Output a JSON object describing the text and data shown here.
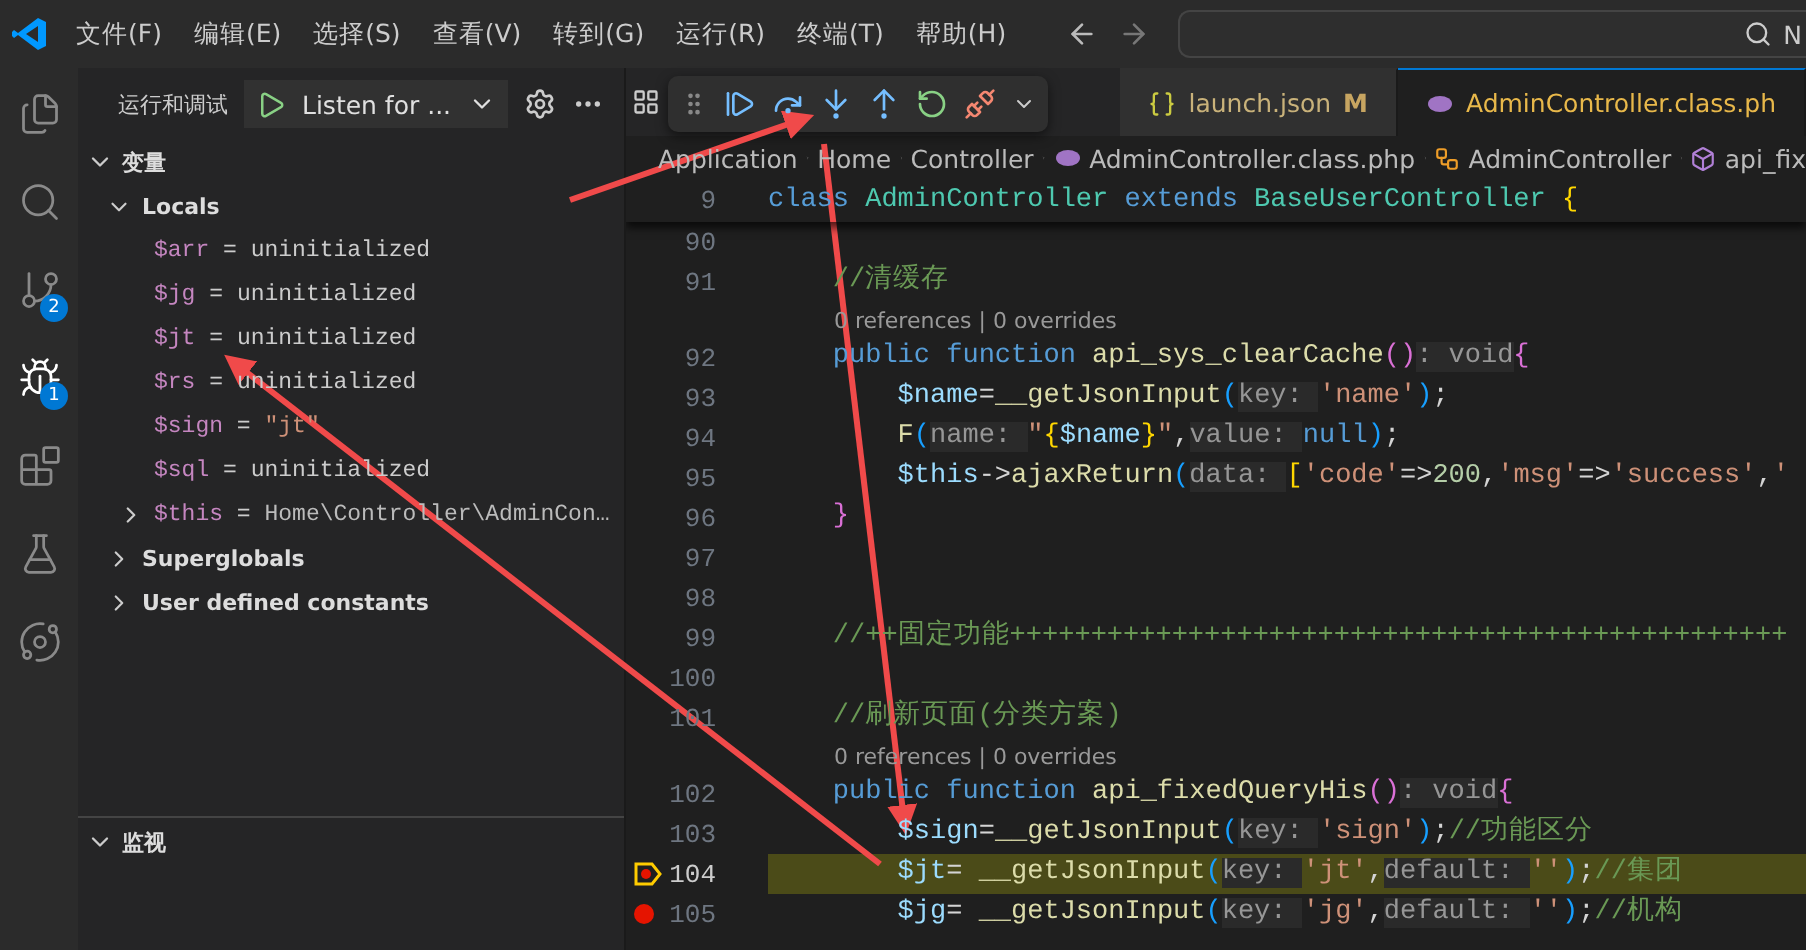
{
  "title_bar": {
    "menu": [
      "文件(F)",
      "编辑(E)",
      "选择(S)",
      "查看(V)",
      "转到(G)",
      "运行(R)",
      "终端(T)",
      "帮助(H)"
    ],
    "search": {
      "value": "N"
    }
  },
  "activity_bar": [
    {
      "selected": false
    },
    {
      "selected": false
    },
    {
      "badge": "2",
      "selected": false
    },
    {
      "badge": "1",
      "selected": true
    },
    {
      "selected": false
    },
    {
      "selected": false
    },
    {
      "selected": false
    }
  ],
  "sidebar": {
    "title": "运行和调试",
    "config": "Listen for ...",
    "variables": {
      "title": "变量",
      "expanded": true,
      "scopes": [
        {
          "name": "Locals",
          "expanded": true,
          "items": [
            {
              "name": "$arr",
              "sep": "=",
              "value": "uninitialized",
              "kind": "plain"
            },
            {
              "name": "$jg",
              "sep": "=",
              "value": "uninitialized",
              "kind": "plain"
            },
            {
              "name": "$jt",
              "sep": "=",
              "value": "uninitialized",
              "kind": "plain"
            },
            {
              "name": "$rs",
              "sep": "=",
              "value": "uninitialized",
              "kind": "plain"
            },
            {
              "name": "$sign",
              "sep": "=",
              "value": "\"jt\"",
              "kind": "string"
            },
            {
              "name": "$sql",
              "sep": "=",
              "value": "uninitialized",
              "kind": "plain"
            },
            {
              "name": "$this",
              "sep": "=",
              "value": "Home\\Controller\\AdminCon…",
              "kind": "object",
              "expanded": false
            }
          ]
        },
        {
          "name": "Superglobals",
          "expanded": false
        },
        {
          "name": "User defined constants",
          "expanded": false
        }
      ]
    },
    "watch": {
      "title": "监视",
      "expanded": true
    }
  },
  "tabs": [
    {
      "label": "launch.json",
      "badge": "M",
      "kind": "json",
      "selected": false
    },
    {
      "label": "AdminController.class.ph",
      "kind": "php",
      "selected": true
    }
  ],
  "breadcrumb": [
    {
      "label": "Application",
      "kind": "folder"
    },
    {
      "label": "Home",
      "kind": "folder"
    },
    {
      "label": "Controller",
      "kind": "folder"
    },
    {
      "label": "AdminController.class.php",
      "kind": "file"
    },
    {
      "label": "AdminController",
      "kind": "class"
    },
    {
      "label": "api_fix",
      "kind": "method"
    }
  ],
  "sticky_line": {
    "number": "9",
    "tokens": [
      {
        "kind": "kw",
        "text": "class "
      },
      {
        "kind": "type",
        "text": "AdminController "
      },
      {
        "kind": "kw",
        "text": "extends "
      },
      {
        "kind": "type",
        "text": "BaseUserController "
      },
      {
        "kind": "b1",
        "text": "{"
      }
    ]
  },
  "lines": [
    {
      "kind": "code",
      "number": "90"
    },
    {
      "kind": "code",
      "number": "91",
      "tokens": [
        {
          "kind": "cm",
          "text": "    //清缓存"
        }
      ]
    },
    {
      "kind": "lens",
      "text": "0 references | 0 overrides"
    },
    {
      "kind": "code",
      "number": "92",
      "tokens": [
        {
          "kind": "kw",
          "text": "    public function "
        },
        {
          "kind": "fn",
          "text": "api_sys_clearCache"
        },
        {
          "kind": "b2",
          "text": "()"
        },
        {
          "kind": "hint",
          "text": ": void"
        },
        {
          "kind": "b2",
          "text": "{"
        }
      ]
    },
    {
      "kind": "code",
      "number": "93",
      "tokens": [
        {
          "kind": "var",
          "text": "        $name"
        },
        {
          "kind": "p",
          "text": "="
        },
        {
          "kind": "fn",
          "text": "__getJsonInput"
        },
        {
          "kind": "b3",
          "text": "("
        },
        {
          "kind": "hint",
          "text": "key: "
        },
        {
          "kind": "str",
          "text": "'name'"
        },
        {
          "kind": "b3",
          "text": ")"
        },
        {
          "kind": "p",
          "text": ";"
        }
      ]
    },
    {
      "kind": "code",
      "number": "94",
      "tokens": [
        {
          "kind": "fn",
          "text": "        F"
        },
        {
          "kind": "b3",
          "text": "("
        },
        {
          "kind": "hint",
          "text": "name: "
        },
        {
          "kind": "str",
          "text": "\""
        },
        {
          "kind": "b1",
          "text": "{"
        },
        {
          "kind": "var",
          "text": "$name"
        },
        {
          "kind": "b1",
          "text": "}"
        },
        {
          "kind": "str",
          "text": "\""
        },
        {
          "kind": "p",
          "text": ","
        },
        {
          "kind": "hint",
          "text": "value: "
        },
        {
          "kind": "kw",
          "text": "null"
        },
        {
          "kind": "b3",
          "text": ")"
        },
        {
          "kind": "p",
          "text": ";"
        }
      ]
    },
    {
      "kind": "code",
      "number": "95",
      "tokens": [
        {
          "kind": "var",
          "text": "        $this"
        },
        {
          "kind": "p",
          "text": "->"
        },
        {
          "kind": "fn",
          "text": "ajaxReturn"
        },
        {
          "kind": "b3",
          "text": "("
        },
        {
          "kind": "hint",
          "text": "data: "
        },
        {
          "kind": "b1",
          "text": "["
        },
        {
          "kind": "str",
          "text": "'code'"
        },
        {
          "kind": "p",
          "text": "=>"
        },
        {
          "kind": "num",
          "text": "200"
        },
        {
          "kind": "p",
          "text": ","
        },
        {
          "kind": "str",
          "text": "'msg'"
        },
        {
          "kind": "p",
          "text": "=>"
        },
        {
          "kind": "str",
          "text": "'success'"
        },
        {
          "kind": "p",
          "text": ","
        },
        {
          "kind": "str",
          "text": "'"
        }
      ]
    },
    {
      "kind": "code",
      "number": "96",
      "tokens": [
        {
          "kind": "b2",
          "text": "    }"
        }
      ]
    },
    {
      "kind": "code",
      "number": "97"
    },
    {
      "kind": "code",
      "number": "98"
    },
    {
      "kind": "code",
      "number": "99",
      "tokens": [
        {
          "kind": "cm",
          "text": "    //++固定功能++++++++++++++++++++++++++++++++++++++++++++++++"
        }
      ]
    },
    {
      "kind": "code",
      "number": "100"
    },
    {
      "kind": "code",
      "number": "101",
      "tokens": [
        {
          "kind": "cm",
          "text": "    //刷新页面(分类方案)"
        }
      ]
    },
    {
      "kind": "lens",
      "text": "0 references | 0 overrides"
    },
    {
      "kind": "code",
      "number": "102",
      "tokens": [
        {
          "kind": "kw",
          "text": "    public function "
        },
        {
          "kind": "fn",
          "text": "api_fixedQueryHis"
        },
        {
          "kind": "b2",
          "text": "()"
        },
        {
          "kind": "hint",
          "text": ": void"
        },
        {
          "kind": "b2",
          "text": "{"
        }
      ]
    },
    {
      "kind": "code",
      "number": "103",
      "tokens": [
        {
          "kind": "var",
          "text": "        $sign"
        },
        {
          "kind": "p",
          "text": "="
        },
        {
          "kind": "fn",
          "text": "__getJsonInput"
        },
        {
          "kind": "b3",
          "text": "("
        },
        {
          "kind": "hint",
          "text": "key: "
        },
        {
          "kind": "str",
          "text": "'sign'"
        },
        {
          "kind": "b3",
          "text": ")"
        },
        {
          "kind": "p",
          "text": ";"
        },
        {
          "kind": "cm",
          "text": "//功能区分"
        }
      ]
    },
    {
      "kind": "current",
      "number": "104",
      "tokens": [
        {
          "kind": "var",
          "text": "        $jt"
        },
        {
          "kind": "p",
          "text": "= "
        },
        {
          "kind": "fn",
          "text": "__getJsonInput"
        },
        {
          "kind": "b3",
          "text": "("
        },
        {
          "kind": "hint",
          "text": "key: "
        },
        {
          "kind": "str",
          "text": "'jt'"
        },
        {
          "kind": "p",
          "text": ","
        },
        {
          "kind": "hint",
          "text": "default: "
        },
        {
          "kind": "str",
          "text": "''"
        },
        {
          "kind": "b3",
          "text": ")"
        },
        {
          "kind": "p",
          "text": ";"
        },
        {
          "kind": "cm",
          "text": "//集团"
        }
      ]
    },
    {
      "kind": "breakpoint",
      "number": "105",
      "tokens": [
        {
          "kind": "var",
          "text": "        $jg"
        },
        {
          "kind": "p",
          "text": "= "
        },
        {
          "kind": "fn",
          "text": "__getJsonInput"
        },
        {
          "kind": "b3",
          "text": "("
        },
        {
          "kind": "hint",
          "text": "key: "
        },
        {
          "kind": "str",
          "text": "'jg'"
        },
        {
          "kind": "p",
          "text": ","
        },
        {
          "kind": "hint",
          "text": "default: "
        },
        {
          "kind": "str",
          "text": "''"
        },
        {
          "kind": "b3",
          "text": ")"
        },
        {
          "kind": "p",
          "text": ";"
        },
        {
          "kind": "cm",
          "text": "//机构"
        }
      ]
    }
  ]
}
